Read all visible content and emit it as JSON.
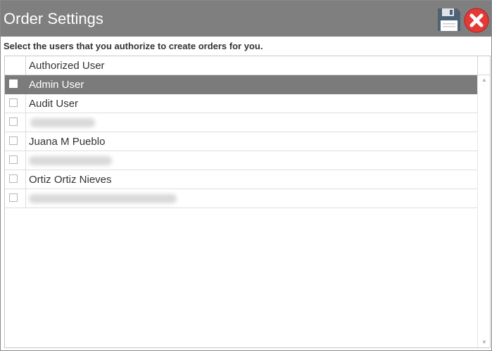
{
  "window": {
    "title": "Order Settings",
    "save_icon": "floppy-disk-icon",
    "close_icon": "close-x-icon",
    "close_color": "#e53935"
  },
  "instructions": "Select the users that you authorize to create orders for you.",
  "grid": {
    "header": "Authorized User",
    "rows": [
      {
        "name": "Admin User",
        "checked": false,
        "selected": true
      },
      {
        "name": "Audit User",
        "checked": false,
        "selected": false
      },
      {
        "name": "",
        "checked": false,
        "selected": false,
        "redacted": true
      },
      {
        "name": "Juana M Pueblo",
        "checked": false,
        "selected": false
      },
      {
        "name": "",
        "checked": false,
        "selected": false,
        "redacted": true
      },
      {
        "name": "Ortiz Ortiz Nieves",
        "checked": false,
        "selected": false
      },
      {
        "name": "",
        "checked": false,
        "selected": false,
        "redacted": true
      }
    ]
  },
  "scrollbar": {
    "up_icon": "scroll-up-arrow-icon",
    "down_icon": "scroll-down-arrow-icon"
  },
  "colors": {
    "titlebar": "#7f7f7f",
    "selected_row": "#7b7b7b"
  }
}
